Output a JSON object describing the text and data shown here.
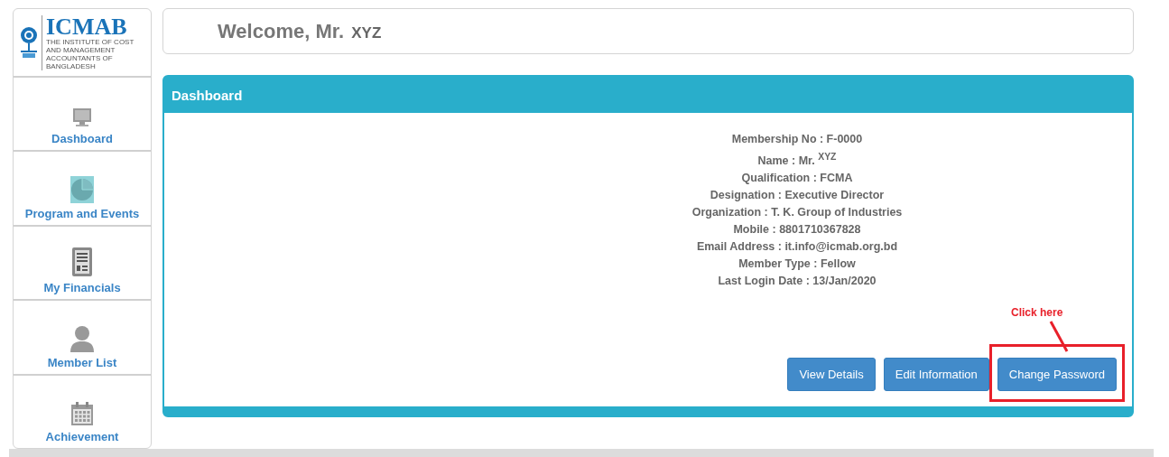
{
  "logo": {
    "name": "ICMAB",
    "line_1": "THE INSTITUTE OF COST AND MANAGEMENT",
    "line_2": "ACCOUNTANTS OF BANGLADESH"
  },
  "sidebar": {
    "items": [
      {
        "label": "Dashboard",
        "kind": "monitor",
        "selected": false
      },
      {
        "label": "Program and Events",
        "kind": "pie",
        "selected": true
      },
      {
        "label": "My Financials",
        "kind": "document",
        "selected": false
      },
      {
        "label": "Member List",
        "kind": "person",
        "selected": false
      },
      {
        "label": "Achievement",
        "kind": "calendar",
        "selected": false
      }
    ]
  },
  "welcome": {
    "greeting": "Welcome, Mr.",
    "name": "XYZ"
  },
  "panel": {
    "title": "Dashboard",
    "details": [
      "Membership No : F-0000",
      "Name : Mr. $^{XYZ}$",
      "Qualification : FCMA",
      "Designation : Executive Director",
      "Organization : T. K. Group of Industries",
      "Mobile : 8801710367828",
      "Email Address : it.info@icmab.org.bd",
      "Member Type : Fellow",
      "Last Login Date : 13/Jan/2020"
    ],
    "buttons": [
      "View Details",
      "Edit Information",
      "Change Password"
    ]
  },
  "annotation": {
    "text": "Click here"
  }
}
